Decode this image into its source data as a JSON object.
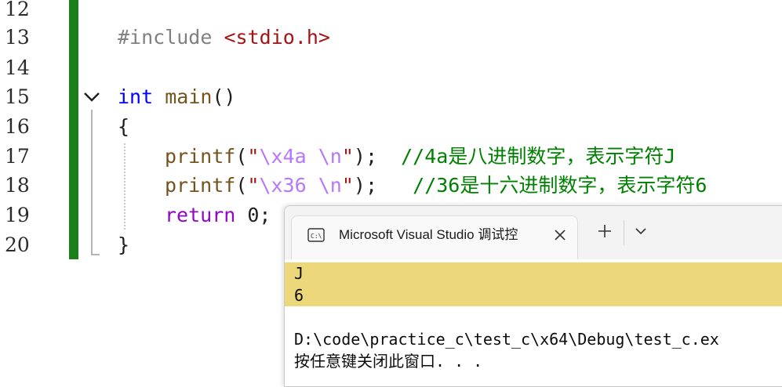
{
  "editor": {
    "line_numbers": [
      "12",
      "13",
      "14",
      "15",
      "16",
      "17",
      "18",
      "19",
      "20"
    ],
    "lines": {
      "l13": {
        "directive": "#include",
        "header": "<stdio.h>"
      },
      "l15": {
        "type": "int",
        "name": "main",
        "parens": "()"
      },
      "l16": {
        "brace": "{"
      },
      "l17": {
        "fn": "printf",
        "open": "(",
        "q1": "\"",
        "esc1": "\\x4a",
        "sp": " ",
        "esc2": "\\n",
        "q2": "\"",
        "close": ");",
        "comment": "//4a是八进制数字，表示字符J"
      },
      "l18": {
        "fn": "printf",
        "open": "(",
        "q1": "\"",
        "esc1": "\\x36",
        "sp": " ",
        "esc2": "\\n",
        "q2": "\"",
        "close": ");",
        "comment": "//36是十六进制数字，表示字符6"
      },
      "l19": {
        "kw": "return",
        "value": "0;"
      },
      "l20": {
        "brace": "}"
      }
    }
  },
  "console": {
    "tab_title": "Microsoft Visual Studio 调试控",
    "icons": {
      "tab": "terminal-icon",
      "close": "close-icon",
      "new_tab": "plus-icon",
      "dropdown": "chevron-down-icon"
    },
    "output": [
      "J",
      "6",
      "",
      "D:\\code\\practice_c\\test_c\\x64\\Debug\\test_c.ex",
      "按任意键关闭此窗口. . ."
    ]
  },
  "colors": {
    "change_bar": "#1a7e1a",
    "keyword": "#0000ff",
    "comment": "#008000",
    "escape": "#b776fb",
    "output_highlight": "#ecd77a"
  }
}
